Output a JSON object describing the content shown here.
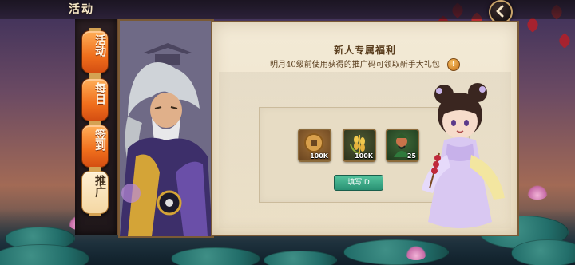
{
  "header": {
    "title": "活动"
  },
  "tabs": [
    {
      "label": "活动",
      "active": false
    },
    {
      "label": "每日",
      "active": false
    },
    {
      "label": "签到",
      "active": false
    },
    {
      "label": "推广",
      "active": true
    }
  ],
  "panel": {
    "title": "新人专属福利",
    "description": "明月40级前使用获得的推广码可领取新手大礼包",
    "info_icon_glyph": "!"
  },
  "rewards": [
    {
      "icon": "copper-coin-icon",
      "quantity": "100K"
    },
    {
      "icon": "grain-icon",
      "quantity": "100K"
    },
    {
      "icon": "general-portrait-icon",
      "quantity": "25"
    }
  ],
  "fill_button": {
    "label": "填写ID"
  },
  "colors": {
    "tab_orange": "#f06f1c",
    "panel_bg": "#f3ead6",
    "button_green": "#2a9173",
    "title_brown": "#5a3e1e"
  }
}
